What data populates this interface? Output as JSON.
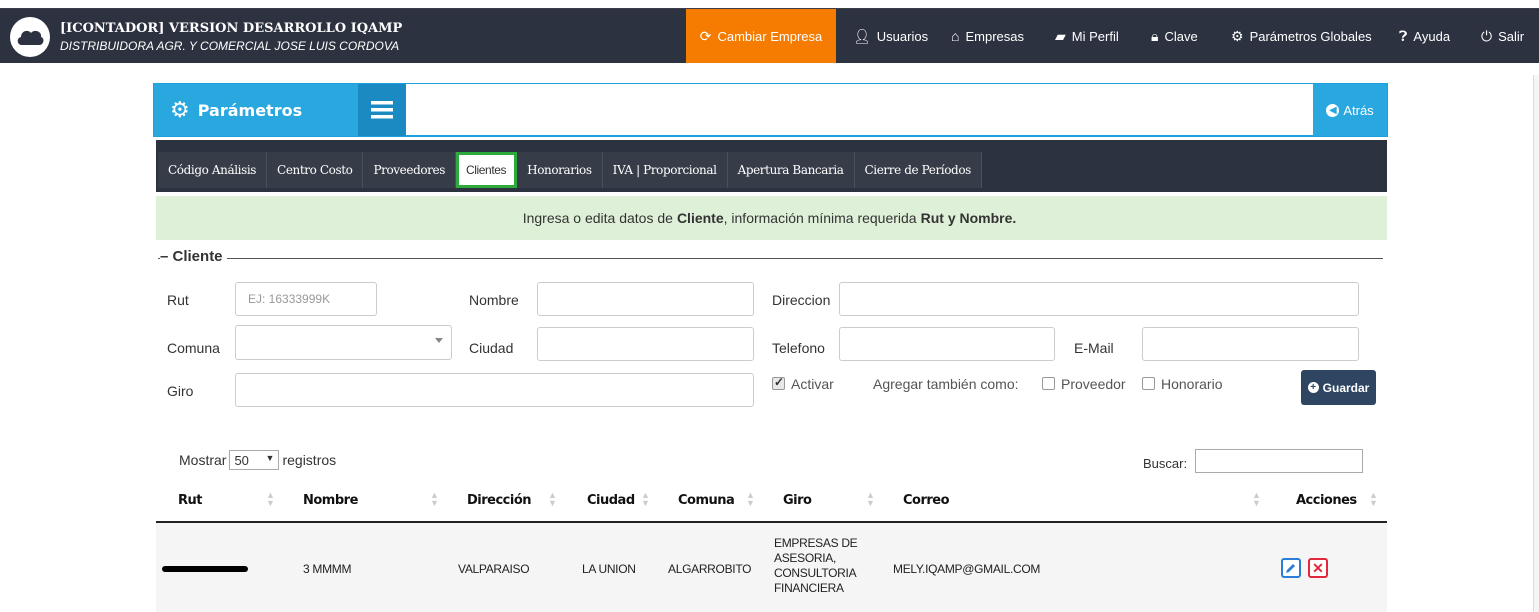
{
  "header": {
    "title": "[ICONTADOR] VERSION DESARROLLO IQAMP",
    "subtitle": "DISTRIBUIDORA AGR. Y COMERCIAL JOSE LUIS CORDOVA",
    "nav": {
      "cambiar": "Cambiar Empresa",
      "usuarios": "Usuarios",
      "empresas": "Empresas",
      "perfil": "Mi Perfil",
      "clave": "Clave",
      "parametros": "Parámetros Globales",
      "ayuda": "Ayuda",
      "salir": "Salir"
    }
  },
  "panel": {
    "title": "Parámetros",
    "back": "Atrás"
  },
  "tabs": [
    "Código Análisis",
    "Centro Costo",
    "Proveedores",
    "Clientes",
    "Honorarios",
    "IVA | Proporcional",
    "Apertura Bancaria",
    "Cierre de Períodos"
  ],
  "info": {
    "pre": "Ingresa o edita datos de",
    "entity": "Cliente",
    "mid": ", información mínima requerida",
    "req": "Rut y Nombre."
  },
  "form": {
    "legend": "Cliente",
    "rut_label": "Rut",
    "rut_placeholder": "EJ: 16333999K",
    "nombre_label": "Nombre",
    "direccion_label": "Direccion",
    "comuna_label": "Comuna",
    "ciudad_label": "Ciudad",
    "telefono_label": "Telefono",
    "email_label": "E-Mail",
    "giro_label": "Giro",
    "activar_label": "Activar",
    "agregar_label": "Agregar también como:",
    "proveedor_label": "Proveedor",
    "honorario_label": "Honorario",
    "guardar": "Guardar"
  },
  "table": {
    "mostrar": "Mostrar",
    "page_size": "50",
    "registros": "registros",
    "buscar": "Buscar:",
    "headers": [
      "Rut",
      "Nombre",
      "Dirección",
      "Ciudad",
      "Comuna",
      "Giro",
      "Correo",
      "Acciones"
    ],
    "rows": [
      {
        "nombre": "3 MMMM",
        "direccion": "VALPARAISO",
        "ciudad": "LA UNION",
        "comuna": "ALGARROBITO",
        "giro": [
          "EMPRESAS DE",
          "ASESORIA,",
          "CONSULTORIA",
          "FINANCIERA"
        ],
        "correo": "MELY.IQAMP@GMAIL.COM"
      }
    ]
  },
  "colors": {
    "navbar": "#2c3240",
    "accent_orange": "#f57c00",
    "accent_blue": "#29a8e0",
    "info_bg": "#dff0d8",
    "active_tab_outline": "#2eaa3c"
  }
}
